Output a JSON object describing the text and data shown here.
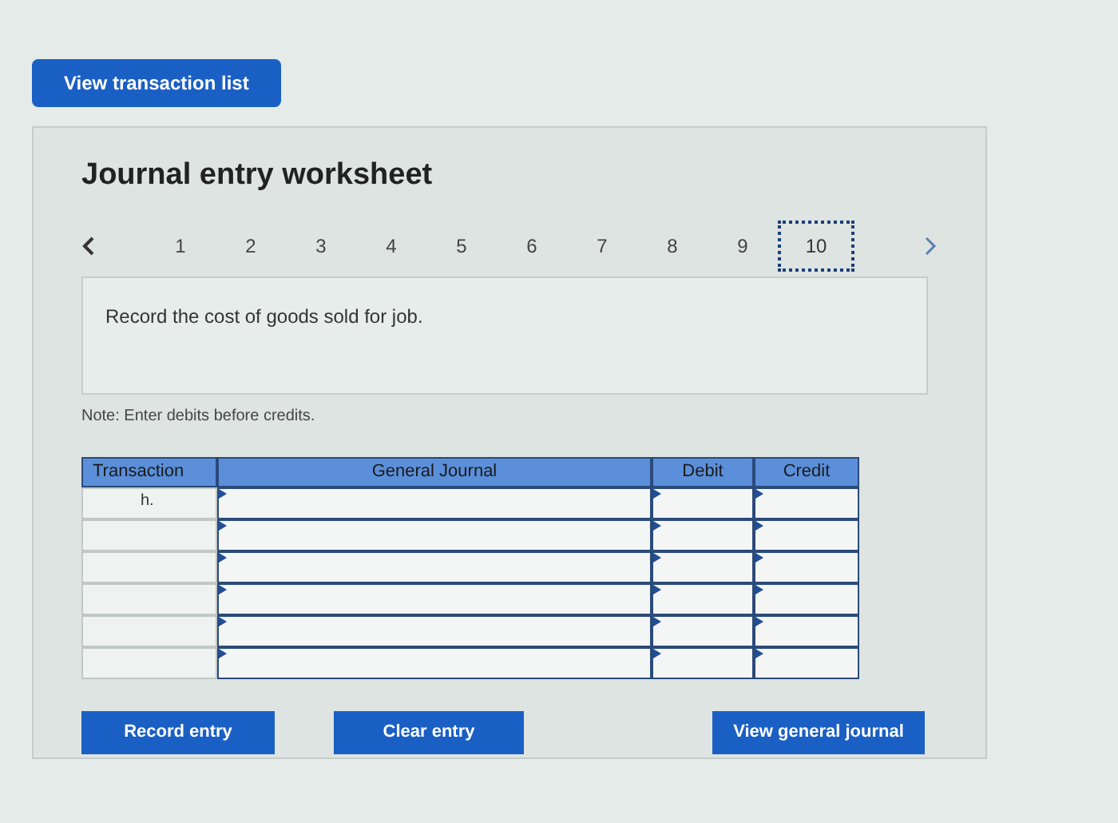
{
  "top_button": "View transaction list",
  "worksheet": {
    "title": "Journal entry worksheet",
    "steps": [
      {
        "label": "1",
        "selected": false
      },
      {
        "label": "2",
        "selected": false
      },
      {
        "label": "3",
        "selected": false
      },
      {
        "label": "4",
        "selected": false
      },
      {
        "label": "5",
        "selected": false
      },
      {
        "label": "6",
        "selected": false
      },
      {
        "label": "7",
        "selected": false
      },
      {
        "label": "8",
        "selected": false
      },
      {
        "label": "9",
        "selected": false
      },
      {
        "label": "10",
        "selected": true
      }
    ],
    "instruction": "Record the cost of goods sold for job.",
    "note": "Note: Enter debits before credits.",
    "table": {
      "columns": [
        "Transaction",
        "General Journal",
        "Debit",
        "Credit"
      ],
      "rows": [
        {
          "transaction": "h."
        },
        {},
        {},
        {},
        {},
        {}
      ]
    },
    "buttons": [
      "Record entry",
      "Clear entry",
      "View general journal"
    ]
  }
}
